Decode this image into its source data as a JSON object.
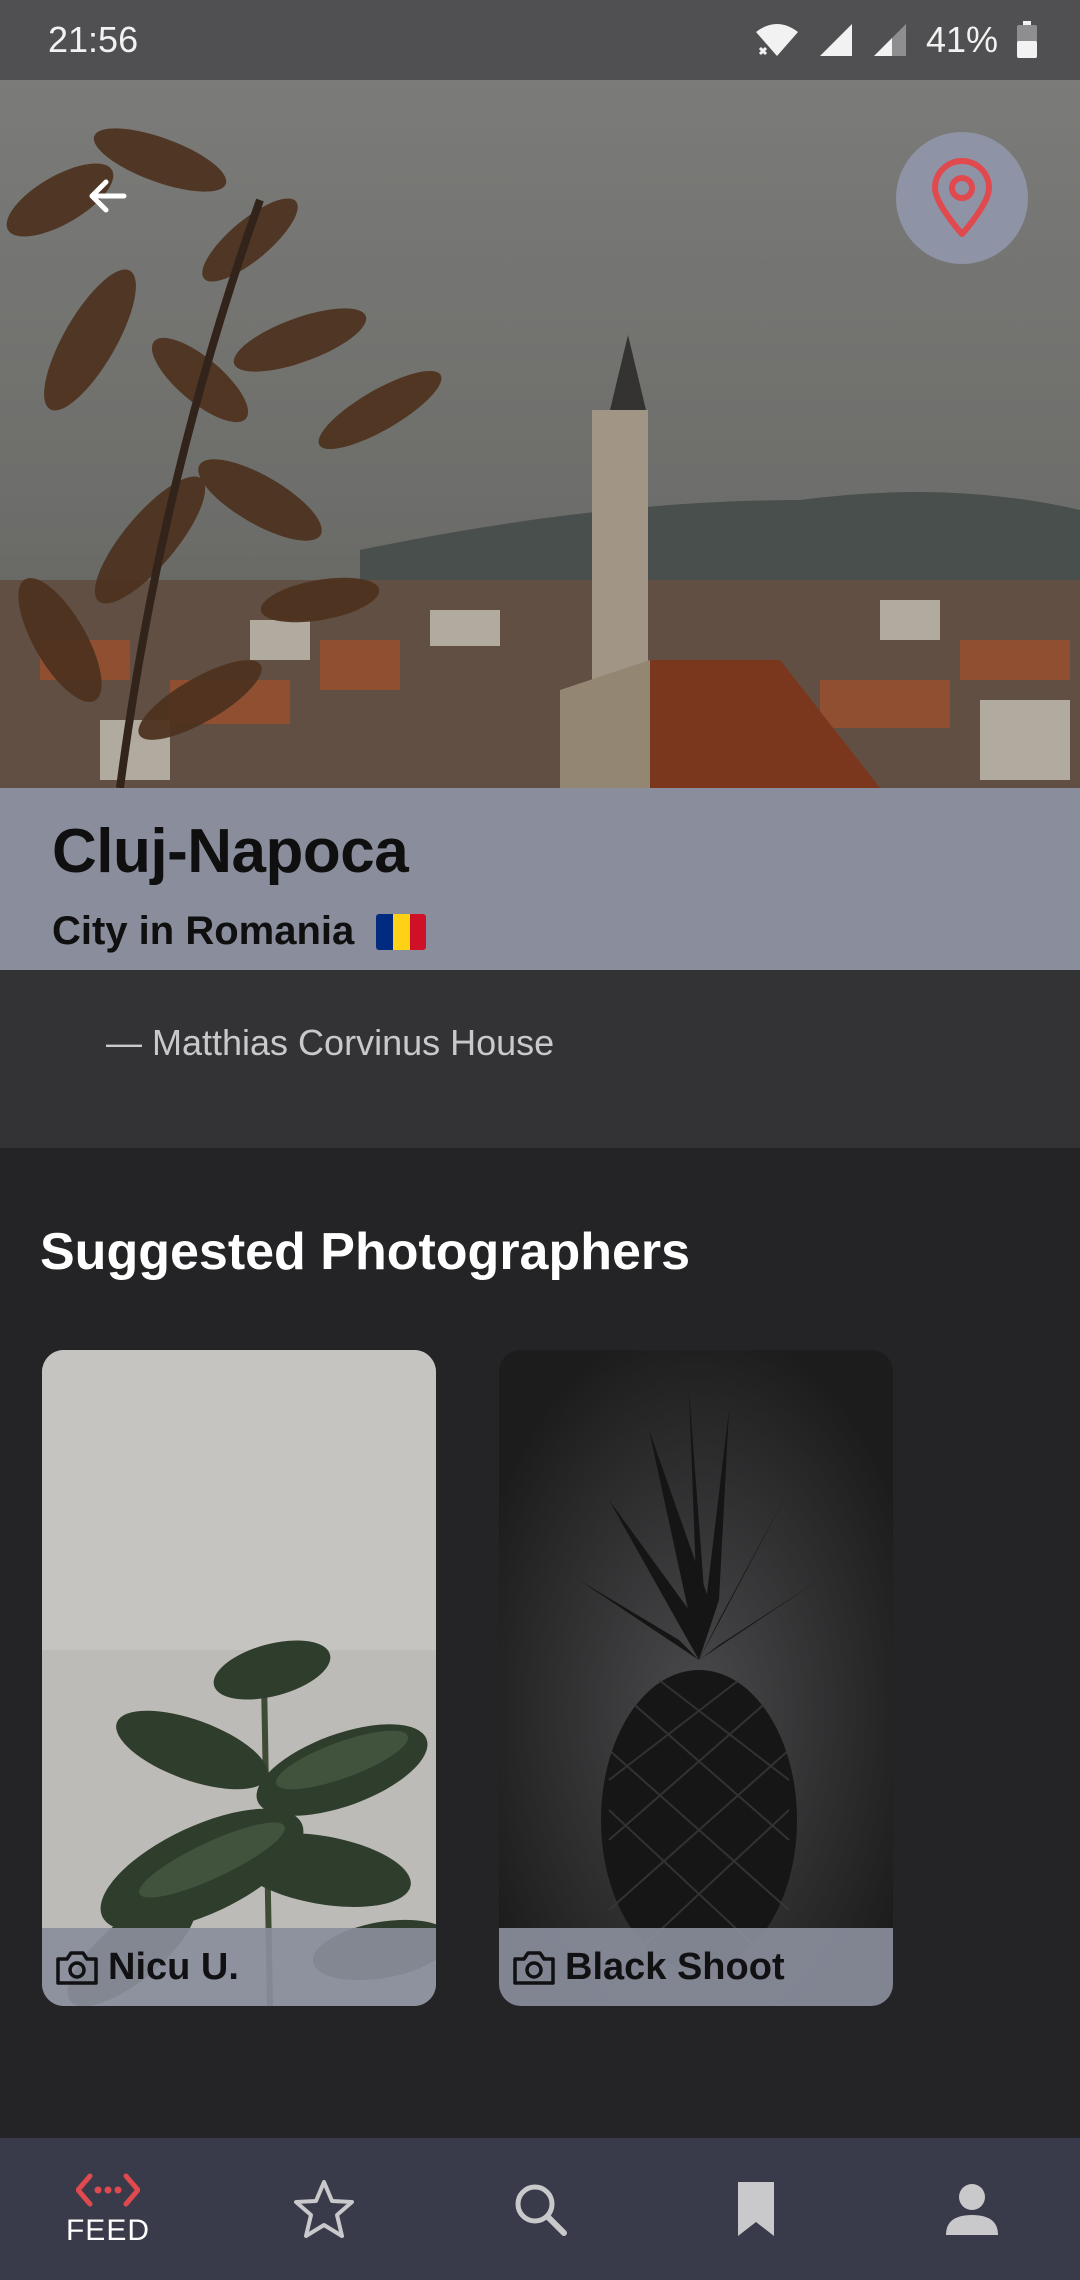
{
  "status_bar": {
    "time": "21:56",
    "battery": "41%",
    "icons": [
      "wifi-icon",
      "signal-icon",
      "signal-weak-icon",
      "battery-icon"
    ]
  },
  "hero": {
    "back_icon": "arrow-left-icon",
    "map_icon": "location-pin-icon"
  },
  "city": {
    "name": "Cluj-Napoca",
    "subtitle": "City in Romania",
    "flag_colors": [
      "#002B7F",
      "#FCD116",
      "#CE1126"
    ]
  },
  "quote": {
    "text": "— Matthias Corvinus House"
  },
  "photographers": {
    "title": "Suggested Photographers",
    "cards": [
      {
        "name": "Nicu U.",
        "icon": "camera-icon"
      },
      {
        "name": "Black Shoot",
        "icon": "camera-icon"
      }
    ]
  },
  "nav": {
    "items": [
      {
        "label": "FEED",
        "icon": "feed-code-icon",
        "active": true
      },
      {
        "label": "",
        "icon": "star-icon"
      },
      {
        "label": "",
        "icon": "search-icon"
      },
      {
        "label": "",
        "icon": "bookmark-icon"
      },
      {
        "label": "",
        "icon": "person-icon"
      }
    ]
  },
  "colors": {
    "accent": "#e04a4f",
    "panel": "#8a8d9b",
    "background": "#242426",
    "nav_background": "#393b4a"
  }
}
